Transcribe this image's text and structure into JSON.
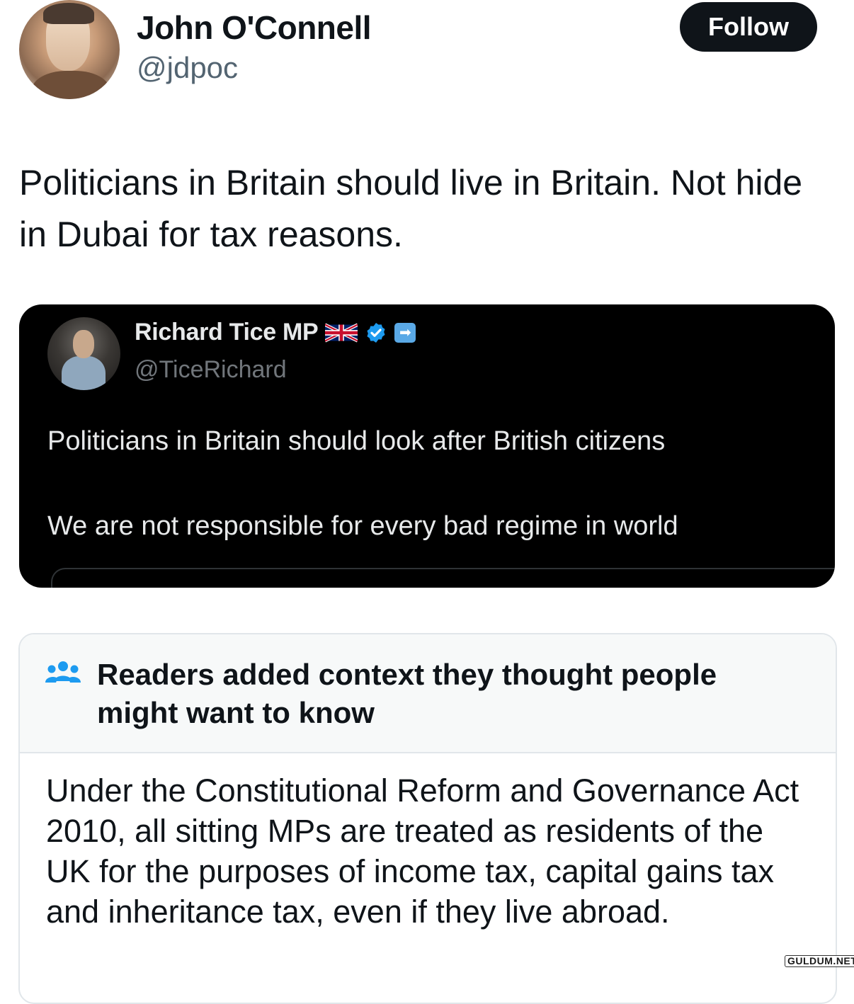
{
  "author": {
    "name": "John O'Connell",
    "handle": "@jdpoc",
    "follow_label": "Follow"
  },
  "tweet": {
    "text": "Politicians in Britain should live in Britain. Not hide in Dubai for tax reasons."
  },
  "quoted_tweet": {
    "name": "Richard Tice MP",
    "handle": "@TiceRichard",
    "line1": "Politicians in Britain should look after British citizens",
    "line2": "We are not responsible for every bad regime in world",
    "icons": [
      "uk-flag-icon",
      "verified-badge-icon",
      "arrow-badge-icon"
    ]
  },
  "community_note": {
    "title": "Readers added context they thought people might want to know",
    "body": "Under the Constitutional Reform and Governance Act 2010, all sitting MPs are treated as residents of the UK for the purposes of income tax, capital gains tax and inheritance tax, even if they live abroad.",
    "icon": "people-icon"
  },
  "watermark": "GULDUM.NET",
  "colors": {
    "text": "#0f1419",
    "secondary": "#536471",
    "quote_bg": "#000000",
    "verified": "#1d9bf0",
    "note_header_bg": "#f7f9f9",
    "note_icon": "#1d9bf0"
  }
}
